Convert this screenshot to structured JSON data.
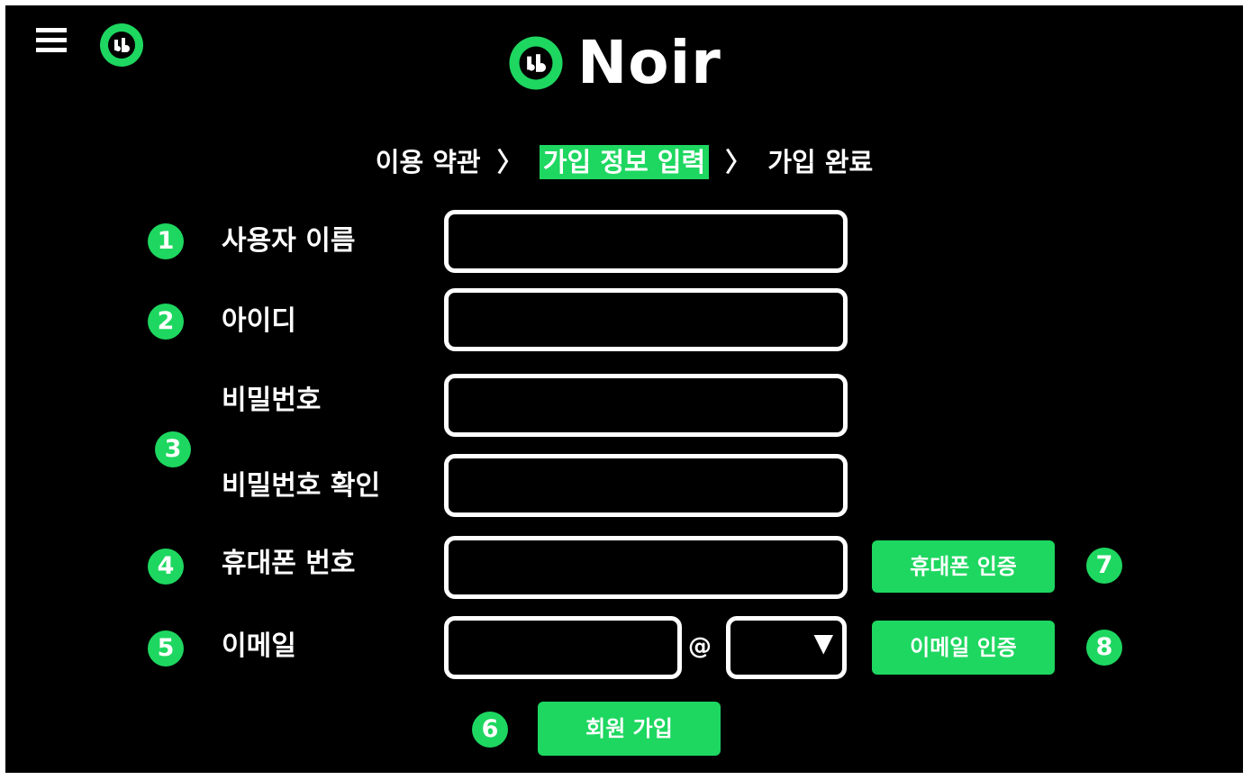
{
  "header": {
    "menu_icon": "hamburger-menu-icon",
    "small_logo_icon": "music-note-logo-icon",
    "brand_name": "Noir",
    "accent_color": "#1ed760"
  },
  "breadcrumb": {
    "step1": "이용 약관",
    "separator1": "〉",
    "step2": "가입 정보 입력",
    "separator2": "〉",
    "step3": "가입 완료"
  },
  "form": {
    "username": {
      "badge": "1",
      "label": "사용자 이름",
      "value": ""
    },
    "user_id": {
      "badge": "2",
      "label": "아이디",
      "value": ""
    },
    "password": {
      "badge": "3",
      "label": "비밀번호",
      "value": ""
    },
    "password_confirm": {
      "label": "비밀번호 확인",
      "value": ""
    },
    "phone": {
      "badge": "4",
      "label": "휴대폰 번호",
      "value": "",
      "verify_button": "휴대폰 인증",
      "verify_badge": "7"
    },
    "email": {
      "badge": "5",
      "label": "이메일",
      "local_value": "",
      "at": "@",
      "domain_arrow": "▼",
      "verify_button": "이메일 인증",
      "verify_badge": "8"
    },
    "submit": {
      "badge": "6",
      "label": "회원 가입"
    }
  }
}
